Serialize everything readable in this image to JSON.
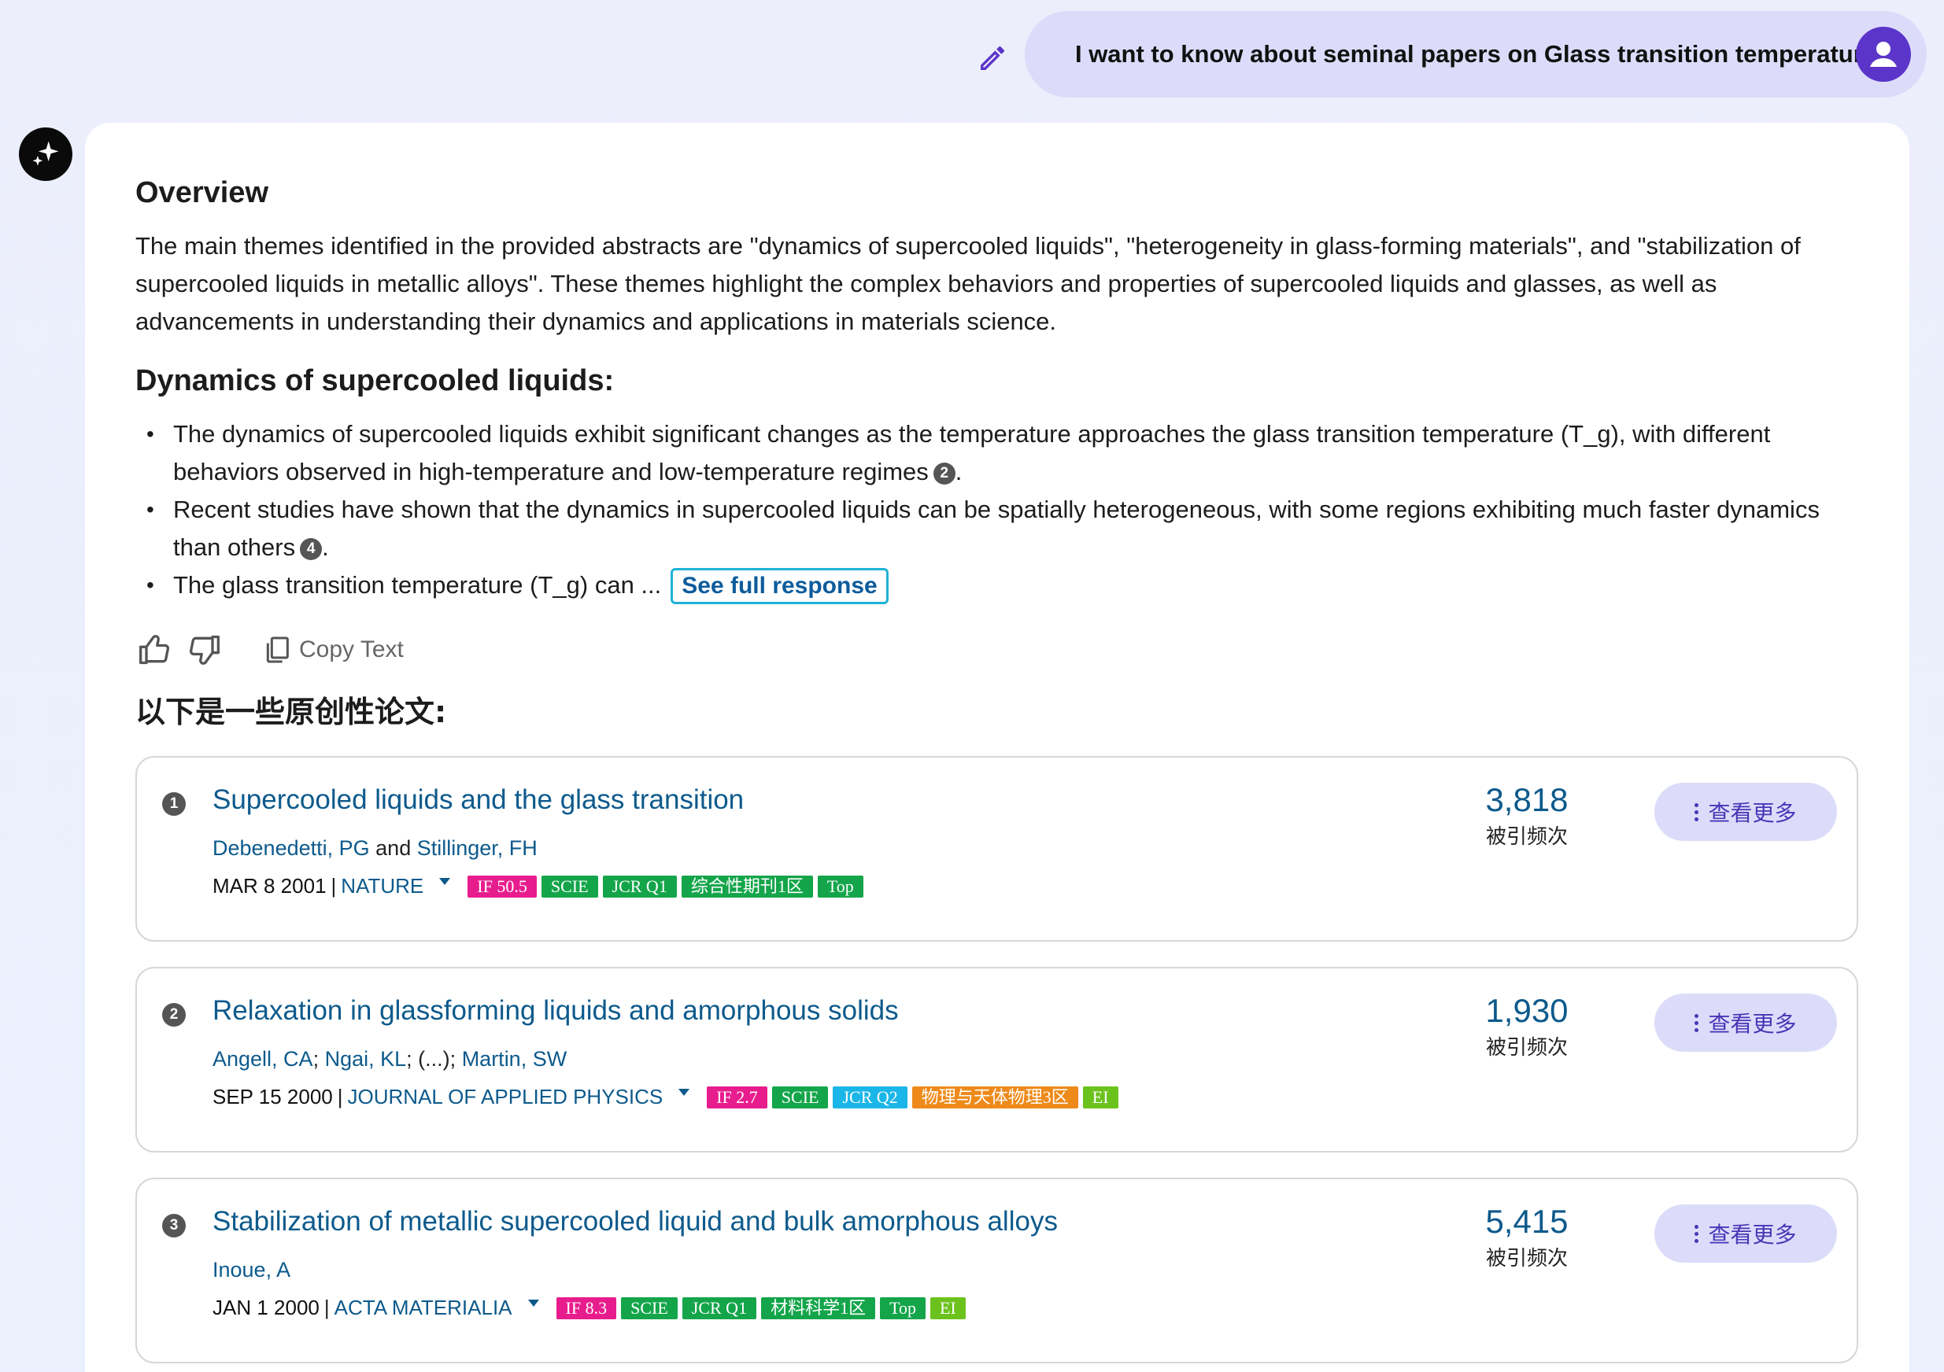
{
  "query": {
    "text": "I want to know about seminal papers on Glass transition temperature"
  },
  "overview": {
    "heading": "Overview",
    "paragraph": "The main themes identified in the provided abstracts are \"dynamics of supercooled liquids\", \"heterogeneity in glass-forming materials\", and \"stabilization of supercooled liquids in metallic alloys\". These themes highlight the complex behaviors and properties of supercooled liquids and glasses, as well as advancements in understanding their dynamics and applications in materials science."
  },
  "section": {
    "heading": "Dynamics of supercooled liquids:",
    "bullets": [
      {
        "text": "The dynamics of supercooled liquids exhibit significant changes as the temperature approaches the glass transition temperature (T_g), with different behaviors observed in high-temperature and low-temperature regimes",
        "cite": "2",
        "end": "."
      },
      {
        "text": "Recent studies have shown that the dynamics in supercooled liquids can be spatially heterogeneous, with some regions exhibiting much faster dynamics than others",
        "cite": "4",
        "end": "."
      },
      {
        "text": "The glass transition temperature (T_g) can ...",
        "cite": "",
        "end": ""
      }
    ],
    "see_full": "See full response"
  },
  "actions": {
    "copy_label": "Copy Text"
  },
  "originals_heading": "以下是一些原创性论文:",
  "papers": [
    {
      "num": "1",
      "title": "Supercooled liquids and the glass transition",
      "authors": [
        "Debenedetti, PG",
        "Stillinger, FH"
      ],
      "author_joiner": "and",
      "date": "MAR 8 2001",
      "journal": "NATURE",
      "tags": [
        "IF 50.5",
        "SCIE",
        "JCR Q1",
        "综合性期刊1区",
        "Top"
      ],
      "citations": "3,818",
      "citations_label": "被引频次",
      "more_label": "查看更多"
    },
    {
      "num": "2",
      "title": "Relaxation in glassforming liquids and amorphous solids",
      "authors": [
        "Angell, CA",
        "Ngai, KL",
        "Martin, SW"
      ],
      "author_ellipsis": "(...)",
      "date": "SEP 15 2000",
      "journal": "JOURNAL OF APPLIED PHYSICS",
      "tags": [
        "IF 2.7",
        "SCIE",
        "JCR Q2",
        "物理与天体物理3区",
        "EI"
      ],
      "citations": "1,930",
      "citations_label": "被引频次",
      "more_label": "查看更多"
    },
    {
      "num": "3",
      "title": "Stabilization of metallic supercooled liquid and bulk amorphous alloys",
      "authors": [
        "Inoue, A"
      ],
      "date": "JAN 1 2000",
      "journal": "ACTA MATERIALIA",
      "tags": [
        "IF 8.3",
        "SCIE",
        "JCR Q1",
        "材料科学1区",
        "Top",
        "EI"
      ],
      "citations": "5,415",
      "citations_label": "被引频次",
      "more_label": "查看更多"
    }
  ],
  "colors": {
    "accent": "#5b35c9",
    "link": "#0d5a8c",
    "bubble": "#dcdcfa",
    "tag_if": "#e81d8d",
    "tag_green": "#14a54a",
    "tag_cyan": "#1bb6e8",
    "tag_orange": "#ee8a1a",
    "tag_lime": "#6cc21d"
  },
  "icons": [
    "pencil-icon",
    "user-icon",
    "sparkle-icon",
    "thumbs-up-icon",
    "thumbs-down-icon",
    "copy-icon",
    "more-dots-icon",
    "caret-down-icon"
  ]
}
